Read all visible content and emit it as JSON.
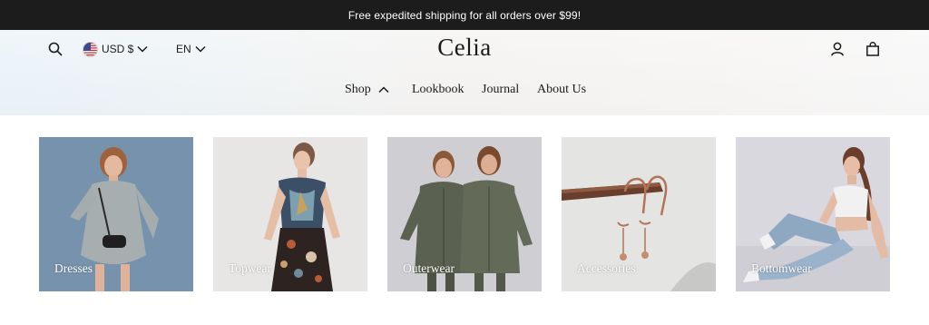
{
  "announcement": {
    "text": "Free expedited shipping for all orders over $99!"
  },
  "header": {
    "logo": "Celia",
    "currency": "USD $",
    "language": "EN"
  },
  "nav": {
    "items": [
      {
        "label": "Shop"
      },
      {
        "label": "Lookbook"
      },
      {
        "label": "Journal"
      },
      {
        "label": "About Us"
      }
    ]
  },
  "categories": [
    {
      "label": "Dresses"
    },
    {
      "label": "Topwear"
    },
    {
      "label": "Outerwear"
    },
    {
      "label": "Accessories"
    },
    {
      "label": "Bottomwear"
    }
  ],
  "icons": {
    "search": "search-icon",
    "account": "user-icon",
    "cart": "shopping-bag-icon",
    "flag": "us-flag-icon",
    "currency_caret": "chevron-down-icon",
    "language_caret": "chevron-down-icon",
    "shop_caret": "chevron-up-icon"
  },
  "colors": {
    "announcement_bg": "#1c1c1c",
    "text_dark": "#1a1a1a",
    "label_text": "#ffffff"
  }
}
